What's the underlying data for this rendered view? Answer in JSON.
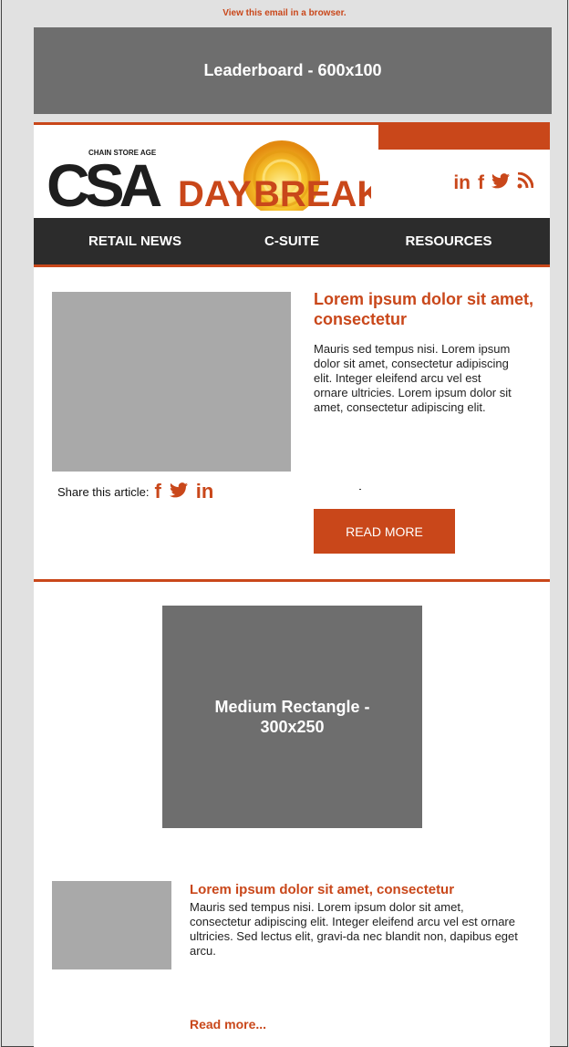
{
  "preheader": {
    "view_in_browser": "View this email in a browser."
  },
  "ads": {
    "leaderboard": "Leaderboard - 600x100",
    "medium_rectangle_line1": "Medium Rectangle -",
    "medium_rectangle_line2": "300x250"
  },
  "header": {
    "logo_small": "CHAIN STORE AGE",
    "logo_csa": "CSA",
    "logo_day": "DAY",
    "logo_breaker": "BREAKER",
    "social_icons": [
      "linkedin-icon",
      "facebook-icon",
      "twitter-icon",
      "rss-icon"
    ],
    "social_glyphs": {
      "linkedin": "in",
      "facebook": "f",
      "twitter": "🐦",
      "rss": "))"
    }
  },
  "nav": {
    "items": [
      "RETAIL NEWS",
      "C-SUITE",
      "RESOURCES"
    ]
  },
  "featured": {
    "title": "Lorem ipsum dolor sit amet, consectetur",
    "body": "Mauris sed tempus nisi. Lorem ipsum dolor sit amet, consectetur adipiscing elit. Integer eleifend arcu vel est ornare ultricies. Lorem ipsum dolor sit amet, consectetur adipiscing elit.",
    "share_label": "Share this article:",
    "share_glyphs": {
      "facebook": "f",
      "twitter": "🐦",
      "linkedin": "in"
    },
    "read_more": "READ MORE"
  },
  "secondary": {
    "title": "Lorem ipsum dolor sit amet, consectetur",
    "body": "Mauris sed tempus nisi. Lorem ipsum dolor sit amet, consectetur adipiscing elit. Integer eleifend arcu vel est ornare ultricies. Sed lectus elit, gravi-da nec blandit non, dapibus eget arcu.",
    "read_more": "Read more..."
  },
  "colors": {
    "accent": "#c9471a",
    "ad_gray": "#6e6e6e",
    "img_gray": "#a9a9a9",
    "nav_bg": "#2c2c2c"
  }
}
